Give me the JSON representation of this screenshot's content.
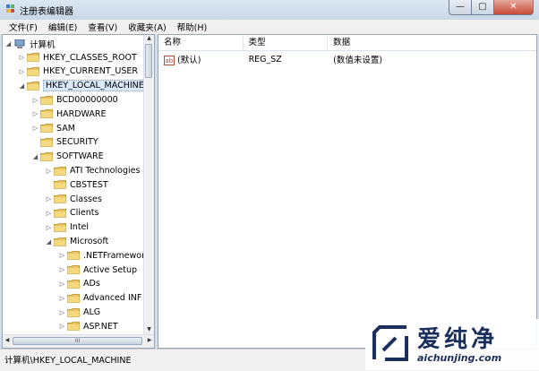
{
  "window": {
    "title": "注册表编辑器",
    "min": "—",
    "max": "▢",
    "close": "✕"
  },
  "menu": [
    {
      "label": "文件(F)"
    },
    {
      "label": "编辑(E)"
    },
    {
      "label": "查看(V)"
    },
    {
      "label": "收藏夹(A)"
    },
    {
      "label": "帮助(H)"
    }
  ],
  "tree": {
    "root": "计算机",
    "items": [
      {
        "label": "HKEY_CLASSES_ROOT",
        "depth": 1,
        "expander": "▷"
      },
      {
        "label": "HKEY_CURRENT_USER",
        "depth": 1,
        "expander": "▷"
      },
      {
        "label": "HKEY_LOCAL_MACHINE",
        "depth": 1,
        "expander": "◢",
        "selected": true
      },
      {
        "label": "BCD00000000",
        "depth": 2,
        "expander": "▷"
      },
      {
        "label": "HARDWARE",
        "depth": 2,
        "expander": "▷"
      },
      {
        "label": "SAM",
        "depth": 2,
        "expander": "▷"
      },
      {
        "label": "SECURITY",
        "depth": 2,
        "expander": ""
      },
      {
        "label": "SOFTWARE",
        "depth": 2,
        "expander": "◢"
      },
      {
        "label": "ATI Technologies",
        "depth": 3,
        "expander": "▷"
      },
      {
        "label": "CBSTEST",
        "depth": 3,
        "expander": ""
      },
      {
        "label": "Classes",
        "depth": 3,
        "expander": "▷"
      },
      {
        "label": "Clients",
        "depth": 3,
        "expander": "▷"
      },
      {
        "label": "Intel",
        "depth": 3,
        "expander": "▷"
      },
      {
        "label": "Microsoft",
        "depth": 3,
        "expander": "◢"
      },
      {
        "label": ".NETFramework",
        "depth": 4,
        "expander": "▷"
      },
      {
        "label": "Active Setup",
        "depth": 4,
        "expander": "▷"
      },
      {
        "label": "ADs",
        "depth": 4,
        "expander": "▷"
      },
      {
        "label": "Advanced INF Setu",
        "depth": 4,
        "expander": "▷"
      },
      {
        "label": "ALG",
        "depth": 4,
        "expander": "▷"
      },
      {
        "label": "ASP.NET",
        "depth": 4,
        "expander": "▷"
      }
    ]
  },
  "list": {
    "columns": {
      "name": "名称",
      "type": "类型",
      "data": "数据"
    },
    "rows": [
      {
        "name": "(默认)",
        "type": "REG_SZ",
        "data": "(数值未设置)"
      }
    ]
  },
  "status": {
    "path": "计算机\\HKEY_LOCAL_MACHINE"
  },
  "scroll": {
    "h_thumb_grip": "III",
    "arrow_up": "▲",
    "arrow_down": "▼",
    "arrow_left": "◀",
    "arrow_right": "▶"
  },
  "watermark": {
    "brand": "爱纯净",
    "url": "aichunjing.com",
    "color": "#1b2f5e"
  },
  "colors": {
    "folder": "#e9c25a",
    "selection": "#d9e8fb"
  }
}
